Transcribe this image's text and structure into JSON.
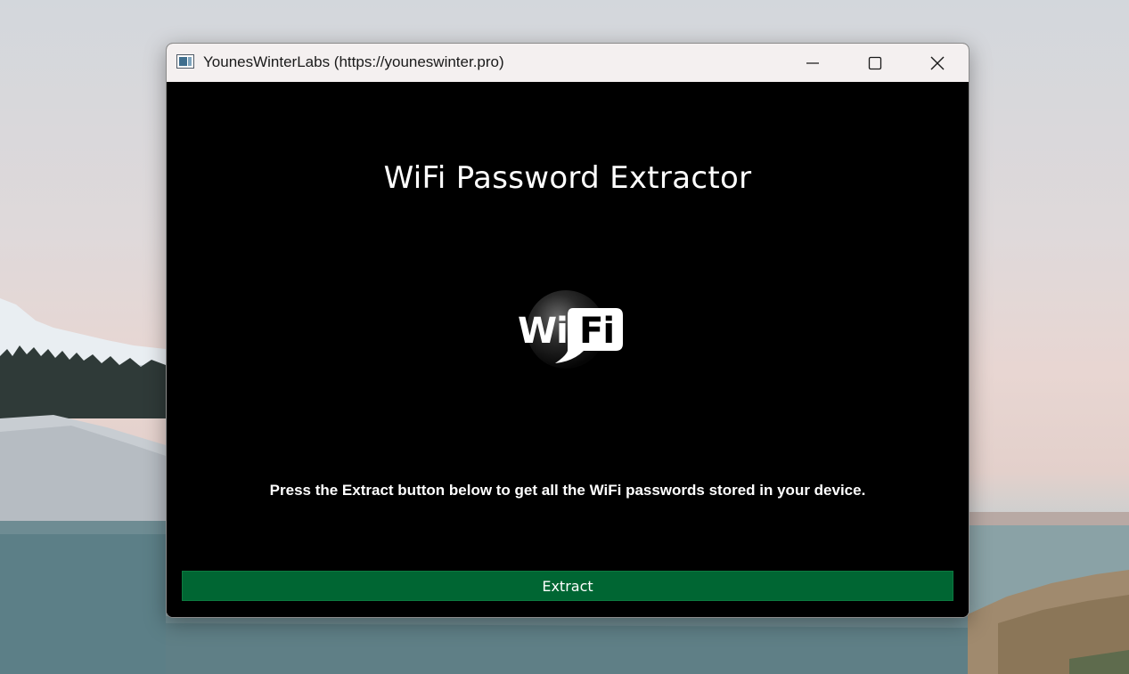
{
  "window": {
    "title": "YounesWinterLabs (https://youneswinter.pro)",
    "controls": {
      "minimize_icon": "minimize-icon",
      "maximize_icon": "maximize-icon",
      "close_icon": "close-icon"
    }
  },
  "main": {
    "heading": "WiFi Password Extractor",
    "logo": {
      "icon": "wifi-logo-icon",
      "text_left": "Wi",
      "text_right": "Fi"
    },
    "instruction": "Press the Extract button below to get all the WiFi passwords stored in your device.",
    "extract_button_label": "Extract"
  },
  "colors": {
    "content_background": "#000000",
    "titlebar_background": "#f4f0f0",
    "button_background": "#006633",
    "text": "#ffffff"
  }
}
